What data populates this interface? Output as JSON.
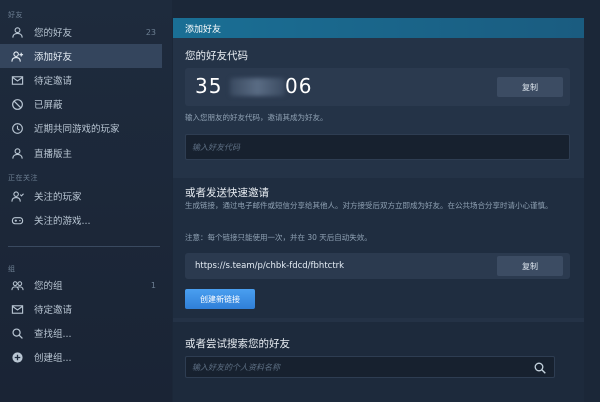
{
  "sidebar": {
    "friends_header": "好友",
    "items_top": [
      {
        "label": "您的好友",
        "count": "23",
        "icon": "person-icon"
      },
      {
        "label": "添加好友",
        "icon": "person-add-icon"
      },
      {
        "label": "待定邀请",
        "icon": "mail-icon"
      },
      {
        "label": "已屏蔽",
        "icon": "block-icon"
      },
      {
        "label": "近期共同游戏的玩家",
        "icon": "clock-icon"
      },
      {
        "label": "直播版主",
        "icon": "person-icon"
      }
    ],
    "following_header": "正在关注",
    "items_follow": [
      {
        "label": "关注的玩家",
        "icon": "person-follow-icon"
      },
      {
        "label": "关注的游戏...",
        "icon": "gamepad-icon"
      }
    ],
    "groups_header": "组",
    "items_groups": [
      {
        "label": "您的组",
        "count": "1",
        "icon": "group-icon"
      },
      {
        "label": "待定邀请",
        "icon": "mail-icon"
      },
      {
        "label": "查找组...",
        "icon": "search-icon"
      },
      {
        "label": "创建组...",
        "icon": "plus-circle-icon"
      }
    ]
  },
  "main": {
    "tab_title": "添加好友",
    "code_section": {
      "title": "您的好友代码",
      "code_prefix": "35",
      "code_suffix": "06",
      "copy_label": "复制",
      "hint": "输入您朋友的好友代码，邀请其成为好友。",
      "input_placeholder": "输入好友代码"
    },
    "quick_invite": {
      "title": "或者发送快速邀请",
      "description": "生成链接，通过电子邮件或短信分享给其他人。对方接受后双方立即成为好友。在公共场合分享时请小心谨慎。",
      "note": "注意：每个链接只能使用一次，并在 30 天后自动失效。",
      "link": "https://s.team/p/chbk-fdcd/fbhtctrk",
      "copy_label": "复制",
      "create_label": "创建新链接"
    },
    "search_section": {
      "title": "或者尝试搜索您的好友",
      "input_placeholder": "输入好友的个人资料名称"
    }
  }
}
